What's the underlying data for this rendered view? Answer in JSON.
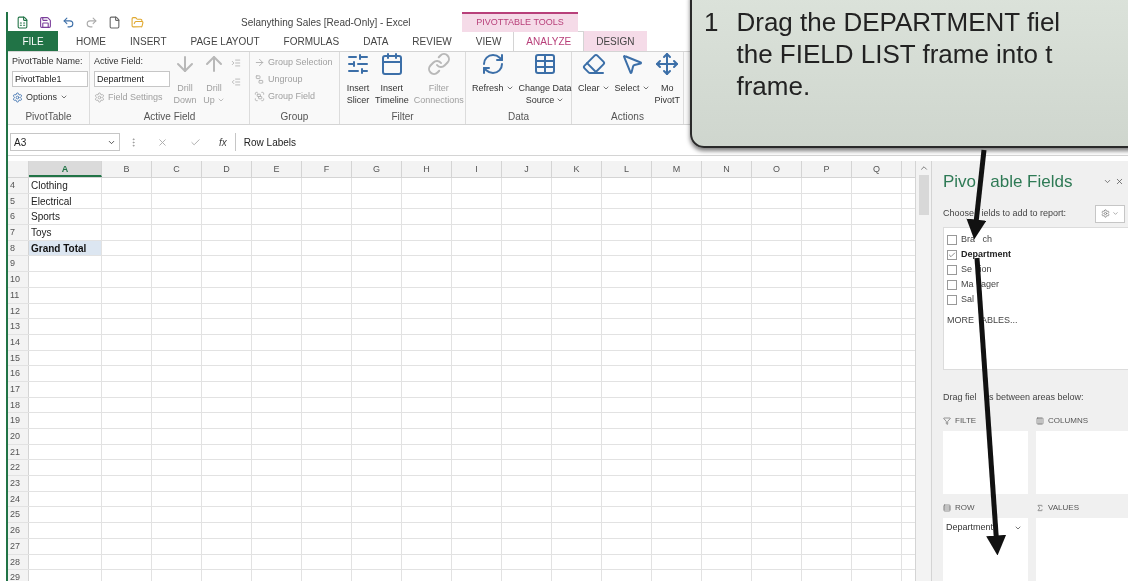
{
  "title_bar": {
    "title": "Selanything Sales  [Read-Only] - Excel",
    "context_group": "PIVOTTABLE TOOLS"
  },
  "ribbon_tabs": [
    {
      "label": "FILE",
      "kind": "file",
      "selected": false,
      "contextual": false
    },
    {
      "label": "HOME",
      "kind": "tab",
      "selected": false,
      "contextual": false
    },
    {
      "label": "INSERT",
      "kind": "tab",
      "selected": false,
      "contextual": false
    },
    {
      "label": "PAGE LAYOUT",
      "kind": "tab",
      "selected": false,
      "contextual": false
    },
    {
      "label": "FORMULAS",
      "kind": "tab",
      "selected": false,
      "contextual": false
    },
    {
      "label": "DATA",
      "kind": "tab",
      "selected": false,
      "contextual": false
    },
    {
      "label": "REVIEW",
      "kind": "tab",
      "selected": false,
      "contextual": false
    },
    {
      "label": "VIEW",
      "kind": "tab",
      "selected": false,
      "contextual": false
    },
    {
      "label": "ANALYZE",
      "kind": "tab",
      "selected": true,
      "contextual": true
    },
    {
      "label": "DESIGN",
      "kind": "tab",
      "selected": false,
      "contextual": true
    }
  ],
  "ribbon_groups": [
    {
      "label": "PivotTable",
      "items": [
        {
          "kind": "stack",
          "items": [
            {
              "kind": "caption",
              "label": "PivotTable Name:"
            },
            {
              "kind": "field",
              "value": "PivotTable1"
            },
            {
              "kind": "small",
              "label": "Options",
              "disabled": false,
              "dropdown": true
            }
          ]
        }
      ]
    },
    {
      "label": "Active Field",
      "items": [
        {
          "kind": "stack",
          "items": [
            {
              "kind": "caption",
              "label": "Active Field:"
            },
            {
              "kind": "field",
              "value": "Department"
            },
            {
              "kind": "small",
              "label": "Field Settings",
              "disabled": true,
              "dropdown": false
            }
          ]
        },
        {
          "kind": "large",
          "lines": [
            "Drill",
            "Down"
          ],
          "disabled": true,
          "dropdown": false
        },
        {
          "kind": "large",
          "lines": [
            "Drill",
            "Up"
          ],
          "disabled": true,
          "dropdown": true
        },
        {
          "kind": "stack",
          "items": [
            {
              "kind": "tiny",
              "disabled": true
            },
            {
              "kind": "tiny",
              "disabled": true
            }
          ]
        }
      ]
    },
    {
      "label": "Group",
      "items": [
        {
          "kind": "stack",
          "items": [
            {
              "kind": "small",
              "label": "Group Selection",
              "disabled": true,
              "dropdown": false
            },
            {
              "kind": "small",
              "label": "Ungroup",
              "disabled": true,
              "dropdown": false
            },
            {
              "kind": "small",
              "label": "Group Field",
              "disabled": true,
              "dropdown": false
            }
          ]
        }
      ]
    },
    {
      "label": "Filter",
      "items": [
        {
          "kind": "large",
          "lines": [
            "Insert",
            "Slicer"
          ],
          "disabled": false,
          "dropdown": false
        },
        {
          "kind": "large",
          "lines": [
            "Insert",
            "Timeline"
          ],
          "disabled": false,
          "dropdown": false
        },
        {
          "kind": "large",
          "lines": [
            "Filter",
            "Connections"
          ],
          "disabled": true,
          "dropdown": false
        }
      ]
    },
    {
      "label": "Data",
      "items": [
        {
          "kind": "large",
          "lines": [
            "Refresh"
          ],
          "disabled": false,
          "dropdown": true
        },
        {
          "kind": "large",
          "lines": [
            "Change Data",
            "Source"
          ],
          "disabled": false,
          "dropdown": true
        }
      ]
    },
    {
      "label": "Actions",
      "items": [
        {
          "kind": "large",
          "lines": [
            "Clear"
          ],
          "disabled": false,
          "dropdown": true
        },
        {
          "kind": "large",
          "lines": [
            "Select"
          ],
          "disabled": false,
          "dropdown": true
        },
        {
          "kind": "large",
          "lines": [
            "Mo",
            "PivotT"
          ],
          "disabled": false,
          "dropdown": false
        }
      ]
    }
  ],
  "formula_bar": {
    "name_box": "A3",
    "function_label": "fx",
    "formula": "Row Labels"
  },
  "worksheet": {
    "columns": [
      {
        "label": "A",
        "selected": true
      },
      {
        "label": "B",
        "selected": false
      },
      {
        "label": "C",
        "selected": false
      },
      {
        "label": "D",
        "selected": false
      },
      {
        "label": "E",
        "selected": false
      },
      {
        "label": "F",
        "selected": false
      },
      {
        "label": "G",
        "selected": false
      },
      {
        "label": "H",
        "selected": false
      },
      {
        "label": "I",
        "selected": false
      },
      {
        "label": "J",
        "selected": false
      },
      {
        "label": "K",
        "selected": false
      },
      {
        "label": "L",
        "selected": false
      },
      {
        "label": "M",
        "selected": false
      },
      {
        "label": "N",
        "selected": false
      },
      {
        "label": "O",
        "selected": false
      },
      {
        "label": "P",
        "selected": false
      },
      {
        "label": "Q",
        "selected": false
      }
    ],
    "rows": [
      {
        "number": "4",
        "cell_a": "Clothing",
        "kind": "item"
      },
      {
        "number": "5",
        "cell_a": "Electrical",
        "kind": "item"
      },
      {
        "number": "6",
        "cell_a": "Sports",
        "kind": "item"
      },
      {
        "number": "7",
        "cell_a": "Toys",
        "kind": "item"
      },
      {
        "number": "8",
        "cell_a": "Grand Total",
        "kind": "total"
      },
      {
        "number": "9"
      },
      {
        "number": "10"
      },
      {
        "number": "11"
      },
      {
        "number": "12"
      },
      {
        "number": "13"
      },
      {
        "number": "14"
      },
      {
        "number": "15"
      },
      {
        "number": "16"
      },
      {
        "number": "17"
      },
      {
        "number": "18"
      },
      {
        "number": "19"
      },
      {
        "number": "20"
      },
      {
        "number": "21"
      },
      {
        "number": "22"
      },
      {
        "number": "23"
      },
      {
        "number": "24"
      },
      {
        "number": "25"
      },
      {
        "number": "26"
      },
      {
        "number": "27"
      },
      {
        "number": "28"
      },
      {
        "number": "29"
      }
    ]
  },
  "field_list": {
    "title": "Pivo   able Fields",
    "subtitle": "Choose   ields to add to report:",
    "fields": [
      {
        "label": "Bra   ch",
        "checked": false
      },
      {
        "label": "Department",
        "checked": true
      },
      {
        "label": "Se   ion",
        "checked": false
      },
      {
        "label": "Ma   ager",
        "checked": false
      },
      {
        "label": "Sal",
        "checked": false
      }
    ],
    "more_tables": "MORE   ABLES...",
    "areas_hint": "Drag fiel     s between areas below:",
    "areas": [
      {
        "label": "FILTE"
      },
      {
        "label": "COLUMNS"
      },
      {
        "label": "ROW"
      },
      {
        "label": "VALUES"
      }
    ],
    "row_items": [
      "Department"
    ]
  },
  "callout": {
    "number": "1",
    "lines": [
      "Drag the DEPARTMENT fiel",
      "the FIELD LIST frame into t",
      "frame."
    ]
  }
}
